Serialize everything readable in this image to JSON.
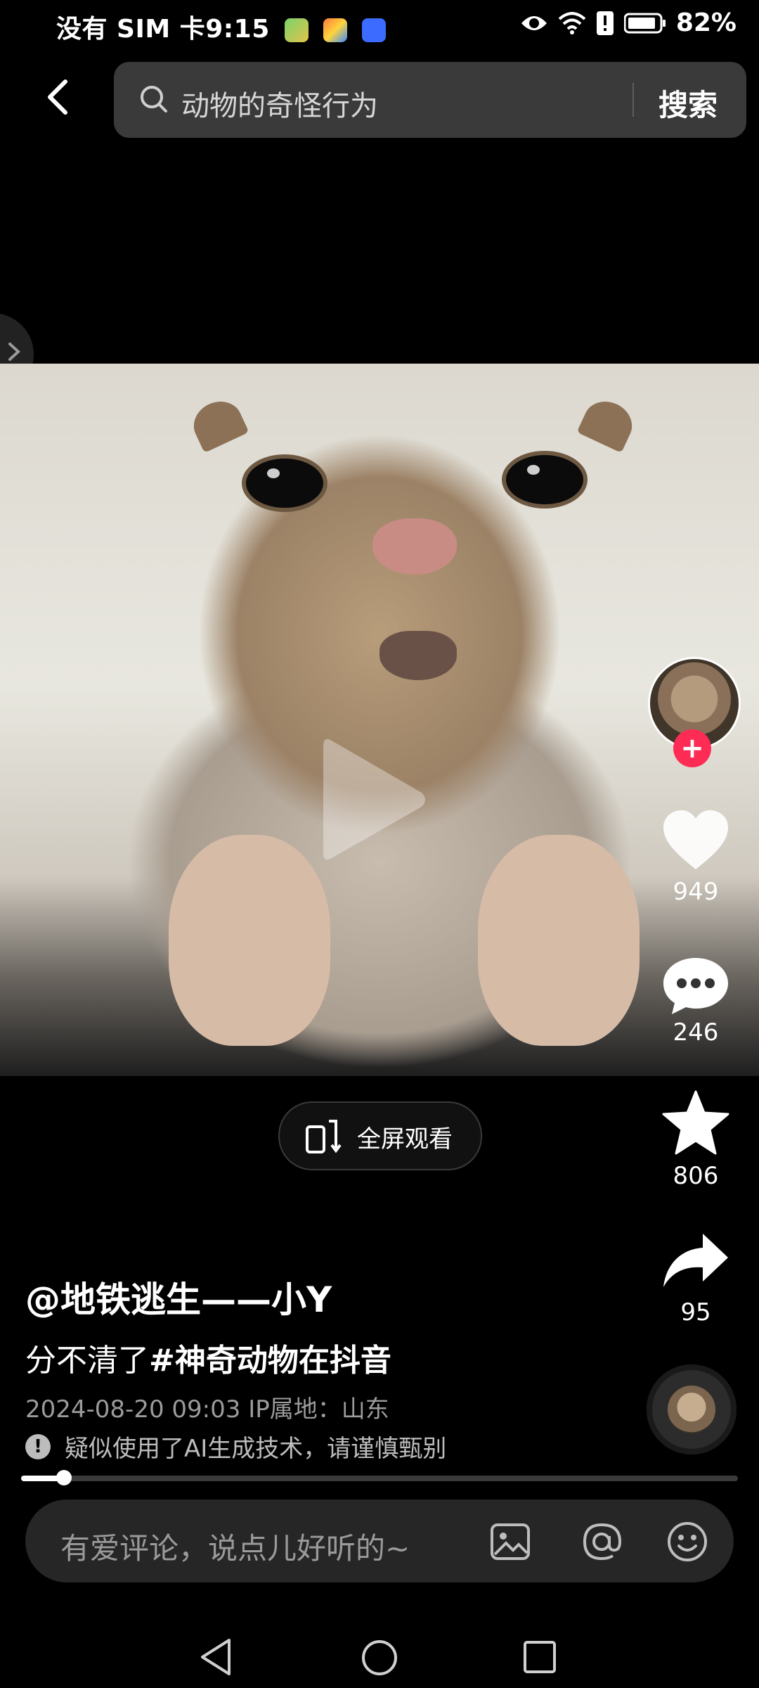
{
  "status_bar": {
    "carrier_time": "没有 SIM 卡9:15",
    "battery": "82%"
  },
  "search": {
    "query": "动物的奇怪行为",
    "button": "搜索"
  },
  "video": {
    "progress_fraction": 0.06
  },
  "actions": {
    "likes": "949",
    "comments": "246",
    "favorites": "806",
    "shares": "95"
  },
  "fullscreen": {
    "label": "全屏观看"
  },
  "post": {
    "author": "@地铁逃生——小Y",
    "desc_prefix": "分不清了",
    "hashtag": "#神奇动物在抖音",
    "meta": "2024-08-20 09:03  IP属地：山东",
    "ai_note": "疑似使用了AI生成技术，请谨慎甄别"
  },
  "comment_bar": {
    "placeholder": "有爱评论，说点儿好听的~"
  },
  "colors": {
    "accent": "#fe2c55",
    "background": "#000000"
  }
}
